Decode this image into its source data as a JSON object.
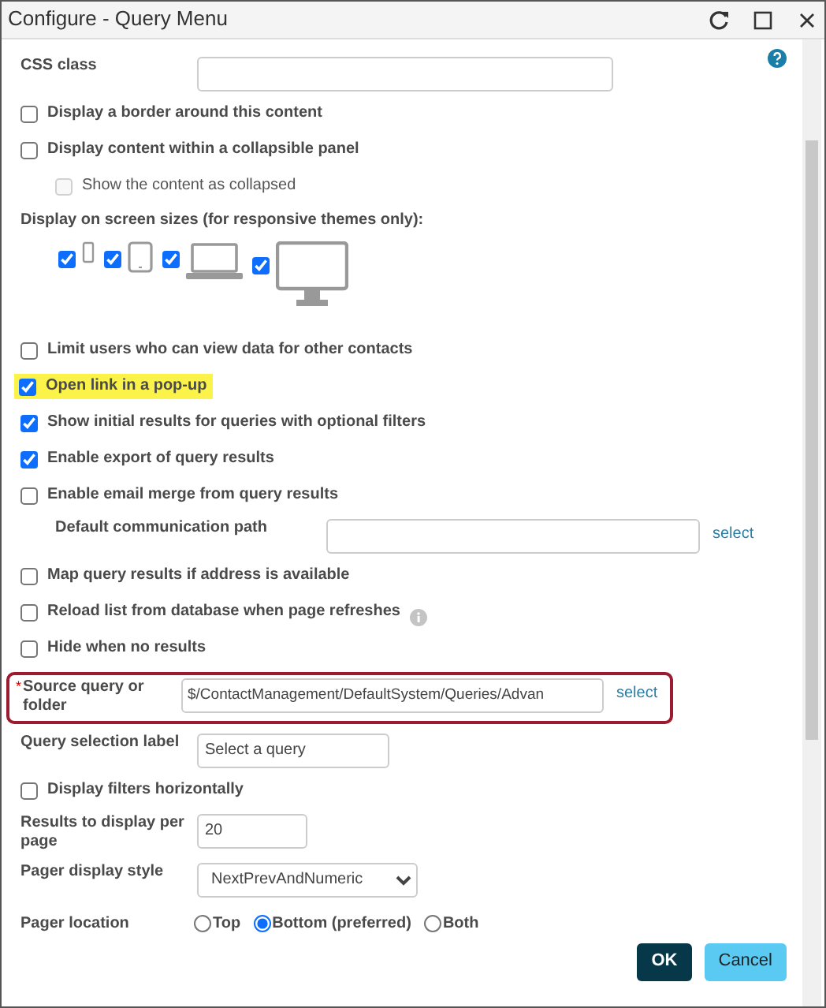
{
  "window": {
    "title": "Configure - Query Menu"
  },
  "rows": [
    {
      "kind": "field",
      "label": "CSS class"
    },
    {
      "kind": "checkbox",
      "label": "Display a border around this content",
      "checked": false
    },
    {
      "kind": "checkbox",
      "label": "Display content within a collapsible panel",
      "checked": false,
      "children": [
        {
          "kind": "checkbox",
          "label": "Show the content as collapsed",
          "checked": false,
          "disabled": true
        }
      ]
    },
    {
      "kind": "devices",
      "label": "Display on screen sizes (for responsive themes only):",
      "screen_sizes": [
        {
          "checked": true
        },
        {
          "checked": true
        },
        {
          "checked": true
        },
        {
          "checked": true
        }
      ]
    },
    {
      "kind": "checkbox",
      "label": "Limit users who can view data for other contacts",
      "checked": false
    },
    {
      "kind": "checkbox",
      "label": "Open link in a pop-up",
      "checked": true,
      "highlighted": true
    },
    {
      "kind": "checkbox",
      "label": "Show initial results for queries with optional filters",
      "checked": true
    },
    {
      "kind": "checkbox",
      "label": "Enable export of query results",
      "checked": true
    },
    {
      "kind": "checkbox",
      "label": "Enable email merge from query results",
      "checked": false,
      "children": [
        {
          "kind": "field",
          "label": "Default communication path",
          "link": "select"
        }
      ]
    },
    {
      "kind": "checkbox",
      "label": "Map query results if address is available",
      "checked": false
    },
    {
      "kind": "checkbox",
      "label": "Reload list from database when page refreshes",
      "checked": false,
      "info": true
    },
    {
      "kind": "checkbox",
      "label": "Hide when no results",
      "checked": false
    },
    {
      "kind": "field",
      "label": "Source query or folder",
      "required_mark": "*",
      "outlined": true,
      "value": "$/ContactManagement/DefaultSystem/Queries/Advan",
      "link": "select"
    },
    {
      "kind": "field",
      "label": "Query selection label",
      "value": "Select a query"
    },
    {
      "kind": "checkbox",
      "label": "Display filters horizontally",
      "checked": false
    },
    {
      "kind": "field",
      "label": "Results to display per page",
      "value": "20"
    },
    {
      "kind": "select",
      "label": "Pager display style",
      "value": "NextPrevAndNumeric"
    },
    {
      "kind": "radio",
      "label": "Pager location",
      "options": [
        {
          "label": "Top",
          "selected": false
        },
        {
          "label": "Bottom (preferred)",
          "selected": true
        },
        {
          "label": "Both",
          "selected": false
        }
      ]
    }
  ],
  "buttons": [
    {
      "label": "OK",
      "kind": "primary"
    },
    {
      "label": "Cancel",
      "kind": "secondary"
    }
  ]
}
